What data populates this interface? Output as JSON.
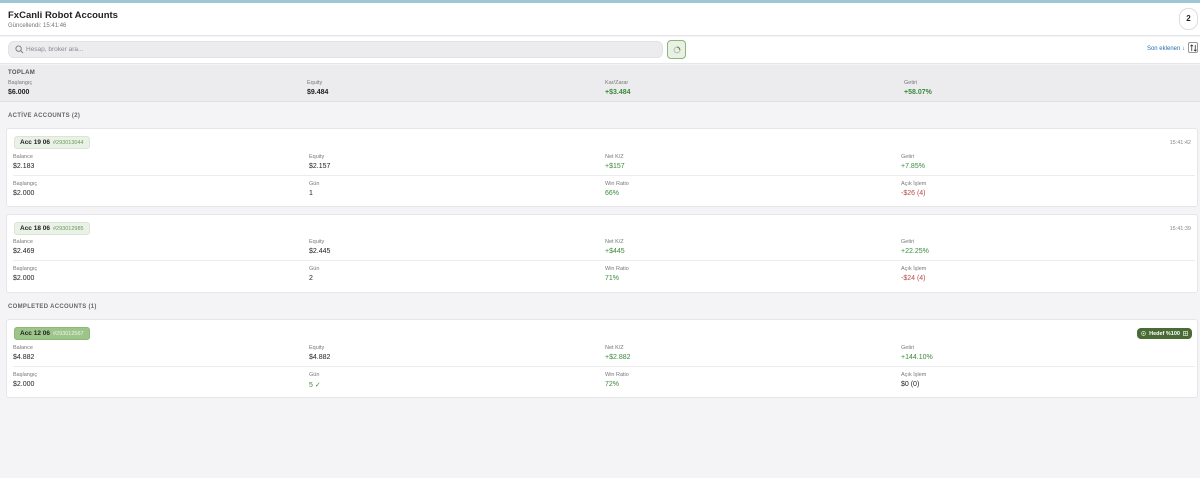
{
  "header": {
    "title": "FxCanli Robot Accounts",
    "subtitle": "Güncellendi: 15:41:46",
    "count": "2"
  },
  "toolbar": {
    "search_placeholder": "Hesap, broker ara...",
    "sort_label": "Son eklenen ↓",
    "icons": {
      "search": "search-icon",
      "refresh": "spinner-icon",
      "sort": "sort-arrows-icon"
    }
  },
  "totals": {
    "title": "TOPLAM",
    "items": [
      {
        "label": "Başlangıç",
        "value": "$6.000",
        "tone": "neutral"
      },
      {
        "label": "Equity",
        "value": "$9.484",
        "tone": "neutral"
      },
      {
        "label": "Kar/Zarar",
        "value": "+$3.484",
        "tone": "pos"
      },
      {
        "label": "Getiri",
        "value": "+58.07%",
        "tone": "pos"
      }
    ]
  },
  "active_section": {
    "title": "ACTİVE ACCOUNTS (2)"
  },
  "completed_section": {
    "title": "COMPLETED ACCOUNTS (1)"
  },
  "accounts": [
    {
      "name": "Acc 19 06",
      "id": "#293013044",
      "time": "15:41:42",
      "fields": [
        {
          "label": "Balance",
          "value": "$2.183",
          "tone": "neutral"
        },
        {
          "label": "Equity",
          "value": "$2.157",
          "tone": "neutral"
        },
        {
          "label": "Net K/Z",
          "value": "+$157",
          "tone": "pos"
        },
        {
          "label": "Getiri",
          "value": "+7.85%",
          "tone": "pos"
        },
        {
          "label": "Başlangıç",
          "value": "$2.000",
          "tone": "neutral"
        },
        {
          "label": "Gün",
          "value": "1",
          "tone": "neutral"
        },
        {
          "label": "Win Ratio",
          "value": "66%",
          "tone": "pos"
        },
        {
          "label": "Açık İşlem",
          "value": "-$26 (4)",
          "tone": "neg"
        }
      ]
    },
    {
      "name": "Acc 18 06",
      "id": "#293012985",
      "time": "15:41:39",
      "fields": [
        {
          "label": "Balance",
          "value": "$2.469",
          "tone": "neutral"
        },
        {
          "label": "Equity",
          "value": "$2.445",
          "tone": "neutral"
        },
        {
          "label": "Net K/Z",
          "value": "+$445",
          "tone": "pos"
        },
        {
          "label": "Getiri",
          "value": "+22.25%",
          "tone": "pos"
        },
        {
          "label": "Başlangıç",
          "value": "$2.000",
          "tone": "neutral"
        },
        {
          "label": "Gün",
          "value": "2",
          "tone": "neutral"
        },
        {
          "label": "Win Ratio",
          "value": "71%",
          "tone": "pos"
        },
        {
          "label": "Açık İşlem",
          "value": "-$24 (4)",
          "tone": "neg"
        }
      ]
    },
    {
      "name": "Acc 12 06",
      "id": "#293012567",
      "badge": "Hedef %100",
      "fields": [
        {
          "label": "Balance",
          "value": "$4.882",
          "tone": "neutral"
        },
        {
          "label": "Equity",
          "value": "$4.882",
          "tone": "neutral"
        },
        {
          "label": "Net K/Z",
          "value": "+$2.882",
          "tone": "pos"
        },
        {
          "label": "Getiri",
          "value": "+144.10%",
          "tone": "pos"
        },
        {
          "label": "Başlangıç",
          "value": "$2.000",
          "tone": "neutral"
        },
        {
          "label": "Gün",
          "value": "5 ✓",
          "tone": "pos"
        },
        {
          "label": "Win Ratio",
          "value": "72%",
          "tone": "pos"
        },
        {
          "label": "Açık İşlem",
          "value": "$0 (0)",
          "tone": "neutral"
        }
      ]
    }
  ],
  "colors": {
    "accent": "#3a8a3a",
    "negative": "#b54a4a",
    "badge": "#4a6b35",
    "chip_done": "#9dc58a"
  }
}
